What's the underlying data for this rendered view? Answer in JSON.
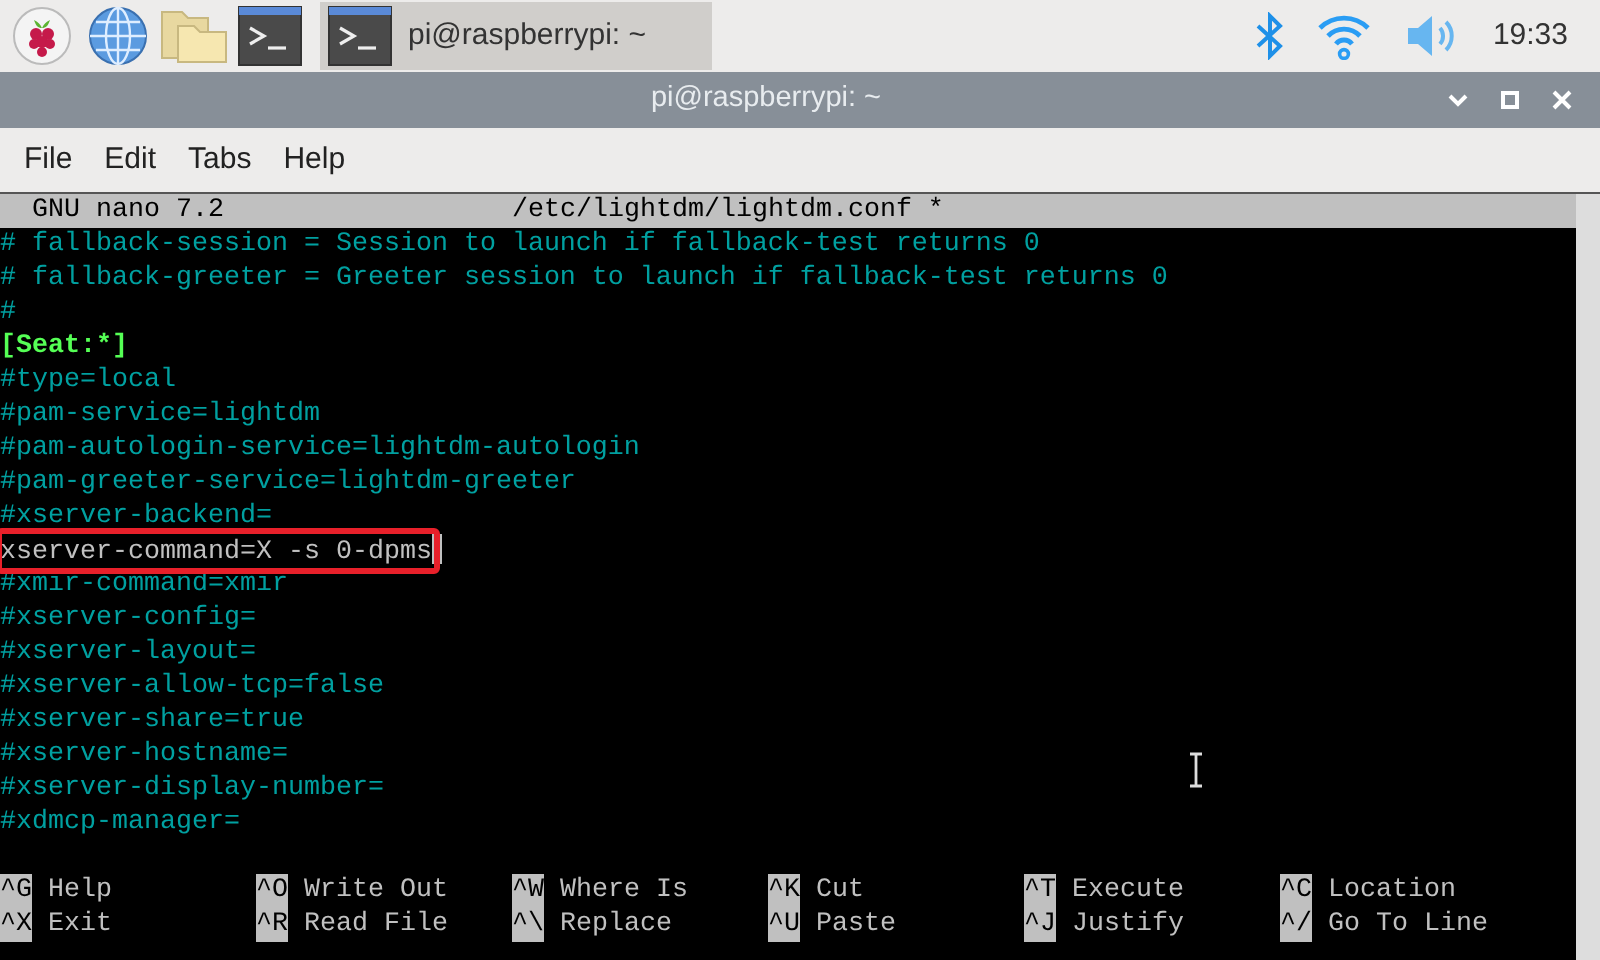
{
  "taskbar": {
    "launchers": [
      {
        "kind": "raspberry"
      },
      {
        "kind": "globe"
      },
      {
        "kind": "folder"
      },
      {
        "kind": "terminal"
      }
    ],
    "tasks": [
      {
        "label": "pi@raspberrypi: ~",
        "selected": true
      }
    ],
    "clock": "19:33"
  },
  "window": {
    "title": "pi@raspberrypi: ~"
  },
  "menu": [
    "File",
    "Edit",
    "Tabs",
    "Help"
  ],
  "editor": {
    "app": "GNU nano 7.2",
    "file": "/etc/lightdm/lightdm.conf *",
    "lines": [
      {
        "text": "# fallback-session = Session to launch if fallback-test returns 0",
        "kind": "comment"
      },
      {
        "text": "# fallback-greeter = Greeter session to launch if fallback-test returns 0",
        "kind": "comment"
      },
      {
        "text": "#",
        "kind": "comment"
      },
      {
        "text": "[Seat:*]",
        "kind": "section"
      },
      {
        "text": "#type=local",
        "kind": "comment"
      },
      {
        "text": "#pam-service=lightdm",
        "kind": "comment"
      },
      {
        "text": "#pam-autologin-service=lightdm-autologin",
        "kind": "comment"
      },
      {
        "text": "#pam-greeter-service=lightdm-greeter",
        "kind": "comment"
      },
      {
        "text": "#xserver-backend=",
        "kind": "comment"
      },
      {
        "text": "xserver-command=X -s 0-dpms",
        "kind": "setting",
        "cursor": true,
        "highlighted": true
      },
      {
        "text": "#xmir-command=xmir",
        "kind": "comment"
      },
      {
        "text": "#xserver-config=",
        "kind": "comment"
      },
      {
        "text": "#xserver-layout=",
        "kind": "comment"
      },
      {
        "text": "#xserver-allow-tcp=false",
        "kind": "comment"
      },
      {
        "text": "#xserver-share=true",
        "kind": "comment"
      },
      {
        "text": "#xserver-hostname=",
        "kind": "comment"
      },
      {
        "text": "#xserver-display-number=",
        "kind": "comment"
      },
      {
        "text": "#xdmcp-manager=",
        "kind": "comment"
      }
    ],
    "shortcuts": [
      [
        {
          "key": "^G",
          "label": "Help"
        },
        {
          "key": "^O",
          "label": "Write Out"
        },
        {
          "key": "^W",
          "label": "Where Is"
        },
        {
          "key": "^K",
          "label": "Cut"
        },
        {
          "key": "^T",
          "label": "Execute"
        },
        {
          "key": "^C",
          "label": "Location"
        }
      ],
      [
        {
          "key": "^X",
          "label": "Exit"
        },
        {
          "key": "^R",
          "label": "Read File"
        },
        {
          "key": "^\\",
          "label": "Replace"
        },
        {
          "key": "^U",
          "label": "Paste"
        },
        {
          "key": "^J",
          "label": "Justify"
        },
        {
          "key": "^/",
          "label": "Go To Line"
        }
      ]
    ]
  }
}
